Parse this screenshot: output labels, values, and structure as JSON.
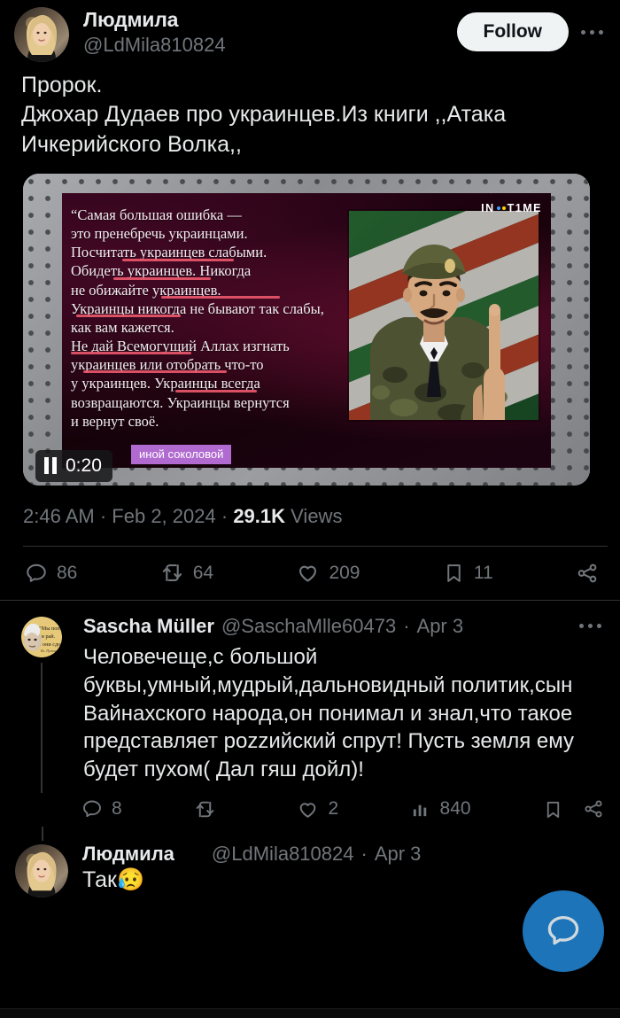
{
  "app": {
    "theme": "dark",
    "background": "#000000",
    "accent": "#1d74b8"
  },
  "tweet": {
    "author": {
      "display_name": "Людмила",
      "flag": "ukraine-flag",
      "handle": "@LdMila810824",
      "avatar": "blonde-woman-avatar"
    },
    "follow_label": "Follow",
    "more_menu": "more-options",
    "text": "Пророк.\nДжохар Дудаев про украинцев.Из книги ,,Атака Ичкерийского Волка,,",
    "media": {
      "type": "video",
      "duration_label": "0:20",
      "playback_state": "playing",
      "control_icon": "pause-icon",
      "watermark": "IN TIME",
      "caption_fragment": "иной соколовой",
      "slide_text": "“Самая большая ошибка —\nэто пренебречь украинцами.\nПосчитать украинцев слабыми.\nОбидеть украинцев. Никогда\nне обижайте украинцев.\nУкраинцы никогда не бывают так слабы,\nкак вам кажется.\nНе дай Всемогущий Аллах изгнать\nукраинцев или отобрать что-то\nу украинцев. Украинцы всегда\nвозвращаются. Украинцы вернутся\nи вернут своё.",
      "highlight_color": "#e8576b",
      "photo_alt": "man-in-military-uniform-before-chechen-flag"
    },
    "meta": {
      "time": "2:46 AM",
      "separator": "·",
      "date": "Feb 2, 2024",
      "views_count": "29.1K",
      "views_label": "Views"
    },
    "actions": [
      {
        "icon": "reply-icon",
        "count": "86"
      },
      {
        "icon": "retweet-icon",
        "count": "64"
      },
      {
        "icon": "like-icon",
        "count": "209"
      },
      {
        "icon": "bookmark-icon",
        "count": "11"
      },
      {
        "icon": "share-icon",
        "count": ""
      }
    ]
  },
  "reply": {
    "author": {
      "display_name": "Sascha Müller",
      "handle": "@SaschaMlle60473",
      "avatar": "caricature-avatar"
    },
    "separator": "·",
    "date": "Apr 3",
    "more_menu": "more-options",
    "text": "Человечеще,с большой буквы,умный,мудрый,дальновидный политик,сын Вайнахского народа,он понимал и знал,что такое представляет роzzийский спрут! Пусть земля ему будет пухом( Дал гяш дойл)!",
    "actions": [
      {
        "icon": "reply-icon",
        "count": "8"
      },
      {
        "icon": "retweet-icon",
        "count": ""
      },
      {
        "icon": "like-icon",
        "count": "2"
      },
      {
        "icon": "views-icon",
        "count": "840"
      },
      {
        "icon": "bookmark-icon",
        "count": ""
      },
      {
        "icon": "share-icon",
        "count": ""
      }
    ]
  },
  "bottom_reply": {
    "author": {
      "display_name": "Людмила",
      "flag": "ukraine-flag",
      "handle": "@LdMila810824",
      "avatar": "blonde-woman-avatar"
    },
    "separator": "·",
    "date": "Apr 3",
    "text": "Так",
    "emoji": "😥"
  },
  "fab": {
    "icon": "compose-message-icon",
    "label": ""
  }
}
